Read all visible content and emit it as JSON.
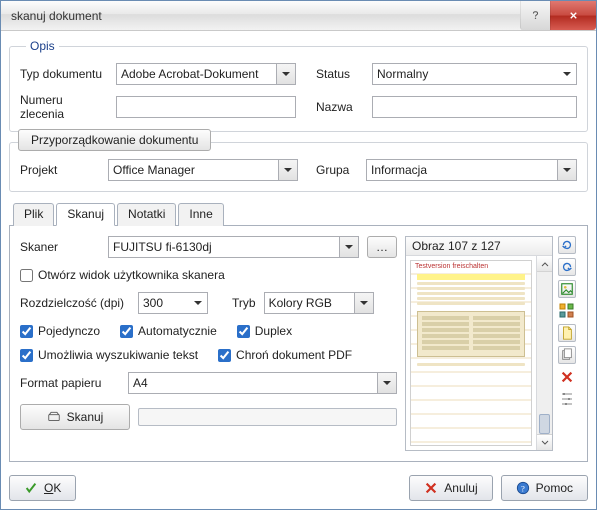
{
  "window": {
    "title": "skanuj dokument"
  },
  "opis": {
    "legend": "Opis",
    "typ_label": "Typ dokumentu",
    "typ_value": "Adobe Acrobat-Dokument",
    "status_label": "Status",
    "status_value": "Normalny",
    "numeru_label": "Numeru zlecenia",
    "numeru_value": "",
    "nazwa_label": "Nazwa",
    "nazwa_value": ""
  },
  "assign": {
    "button_label": "Przyporządkowanie dokumentu",
    "projekt_label": "Projekt",
    "projekt_value": "Office Manager",
    "grupa_label": "Grupa",
    "grupa_value": "Informacja"
  },
  "tabs": {
    "plik": "Plik",
    "skanuj": "Skanuj",
    "notatki": "Notatki",
    "inne": "Inne"
  },
  "scan": {
    "skaner_label": "Skaner",
    "skaner_value": "FUJITSU fi-6130dj",
    "open_ui": "Otwórz widok użytkownika skanera",
    "dpi_label": "Rozdzielczość (dpi)",
    "dpi_value": "300",
    "tryb_label": "Tryb",
    "tryb_value": "Kolory RGB",
    "single": "Pojedynczo",
    "auto": "Automatycznie",
    "duplex": "Duplex",
    "ocr": "Umożliwia wyszukiwanie tekst",
    "protect": "Chroń dokument PDF",
    "format_label": "Format papieru",
    "format_value": "A4",
    "scan_btn": "Skanuj"
  },
  "preview": {
    "caption": "Obraz 107 z 127"
  },
  "footer": {
    "ok_text": "OK",
    "ok_underline": "O",
    "cancel": "Anuluj",
    "help": "Pomoc"
  }
}
